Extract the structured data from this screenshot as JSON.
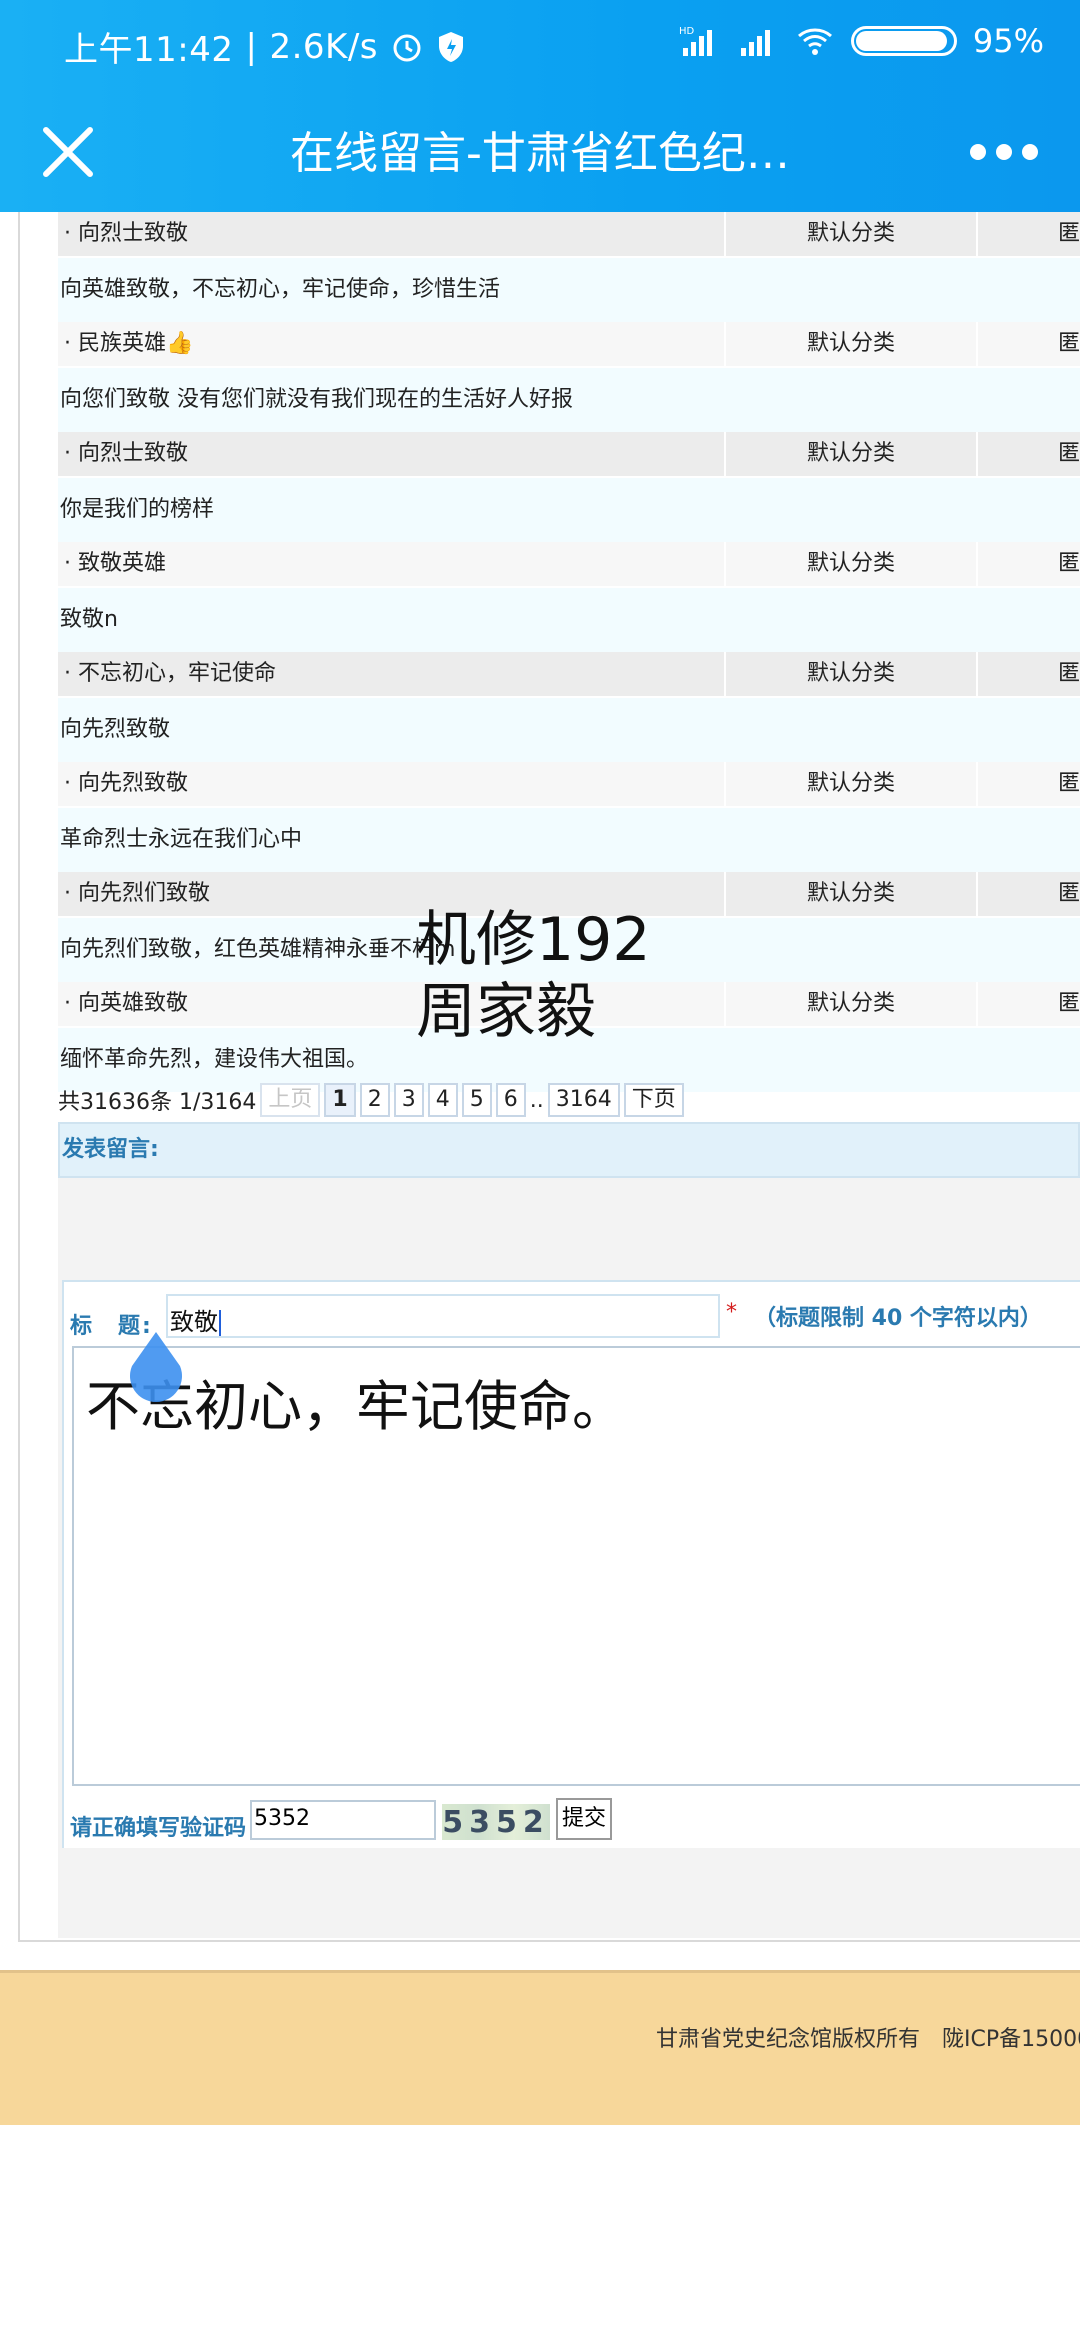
{
  "status_bar": {
    "time": "上午11:42",
    "net_speed": "2.6K/s",
    "battery_percent": 95,
    "battery_label": "95%",
    "icons": [
      "alarm-icon",
      "shield-icon",
      "hd-signal-icon",
      "signal-icon",
      "wifi-icon",
      "battery-icon"
    ]
  },
  "appbar": {
    "title": "在线留言-甘肃省红色纪…",
    "close_icon": "close-icon",
    "more_icon": "more-icon"
  },
  "messages": [
    {
      "title": "· 向烈士致敬",
      "category": "默认分类",
      "more": "匿",
      "content": "向英雄致敬，不忘初心，牢记使命，珍惜生活"
    },
    {
      "title": "· 民族英雄👍",
      "category": "默认分类",
      "more": "匿",
      "content": "向您们致敬 没有您们就没有我们现在的生活好人好报"
    },
    {
      "title": "· 向烈士致敬",
      "category": "默认分类",
      "more": "匿",
      "content": "你是我们的榜样"
    },
    {
      "title": "· 致敬英雄",
      "category": "默认分类",
      "more": "匿",
      "content": "致敬n"
    },
    {
      "title": "· 不忘初心，牢记使命",
      "category": "默认分类",
      "more": "匿",
      "content": "向先烈致敬"
    },
    {
      "title": "· 向先烈致敬",
      "category": "默认分类",
      "more": "匿",
      "content": "革命烈士永远在我们心中"
    },
    {
      "title": "· 向先烈们致敬",
      "category": "默认分类",
      "more": "匿",
      "content": "向先烈们致敬，红色英雄精神永垂不朽m"
    },
    {
      "title": "· 向英雄致敬",
      "category": "默认分类",
      "more": "匿",
      "content": "缅怀革命先烈，建设伟大祖国。"
    }
  ],
  "pager": {
    "summary": "共31636条  1/3164",
    "prev": "上页",
    "pages": [
      "1",
      "2",
      "3",
      "4",
      "5",
      "6"
    ],
    "ellipsis": "..",
    "last": "3164",
    "next": "下页"
  },
  "post": {
    "header": "发表留言:",
    "title_label": "标　题:",
    "title_value": "致敬",
    "required_mark": "*",
    "title_hint": "（标题限制 40 个字符以内）",
    "body_value": "不忘初心，牢记使命。",
    "captcha_label": "请正确填写验证码",
    "captcha_value": "5352",
    "captcha_image_text": "5352",
    "submit": "提交"
  },
  "watermark": {
    "line1": "机修192",
    "line2": "周家毅"
  },
  "footer": {
    "text": "甘肃省党史纪念馆版权所有　陇ICP备15000"
  },
  "colors": {
    "header_blue": "#0aa0f1",
    "label_blue": "#2a7ab0",
    "footer_bg": "#f7d79a",
    "required_red": "#d41c1c"
  }
}
